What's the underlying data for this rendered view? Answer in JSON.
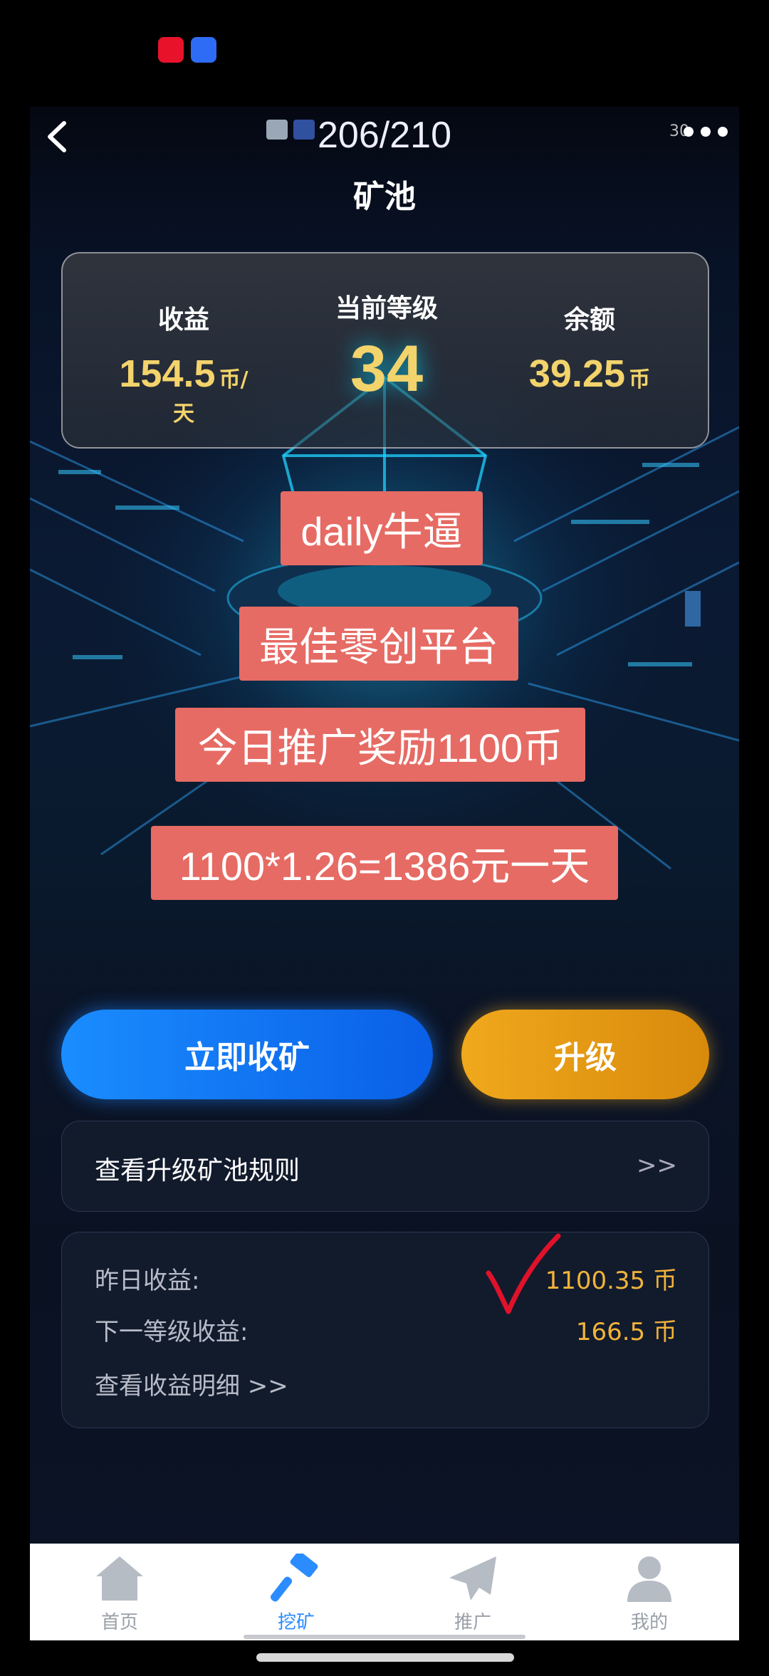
{
  "nav": {
    "counter": "206/210",
    "side_number": "30",
    "title": "矿池"
  },
  "stats": {
    "income_label": "收益",
    "income_value": "154.5",
    "income_unit": "币/天",
    "level_label": "当前等级",
    "level_value": "34",
    "balance_label": "余额",
    "balance_value": "39.25",
    "balance_unit": "币"
  },
  "banners": [
    "daily牛逼",
    "最佳零创平台",
    "今日推广奖励1100币",
    "1100*1.26=1386元一天"
  ],
  "actions": {
    "collect_label": "立即收矿",
    "upgrade_label": "升级"
  },
  "rules": {
    "label": "查看升级矿池规则",
    "arrow": ">>"
  },
  "earnings": {
    "yesterday_label": "昨日收益:",
    "yesterday_value": "1100.35 币",
    "next_level_label": "下一等级收益:",
    "next_level_value": "166.5 币",
    "detail_link": "查看收益明细 >>"
  },
  "tabs": [
    {
      "label": "首页",
      "icon": "home-icon"
    },
    {
      "label": "挖矿",
      "icon": "hammer-icon"
    },
    {
      "label": "推广",
      "icon": "paper-plane-icon"
    },
    {
      "label": "我的",
      "icon": "user-icon"
    }
  ],
  "colors": {
    "accent_gold": "#f3d36b",
    "banner_red": "#e66b64",
    "collect_blue": "#1a8dff",
    "upgrade_orange": "#f0a81c",
    "active_tab": "#2b8cff"
  }
}
